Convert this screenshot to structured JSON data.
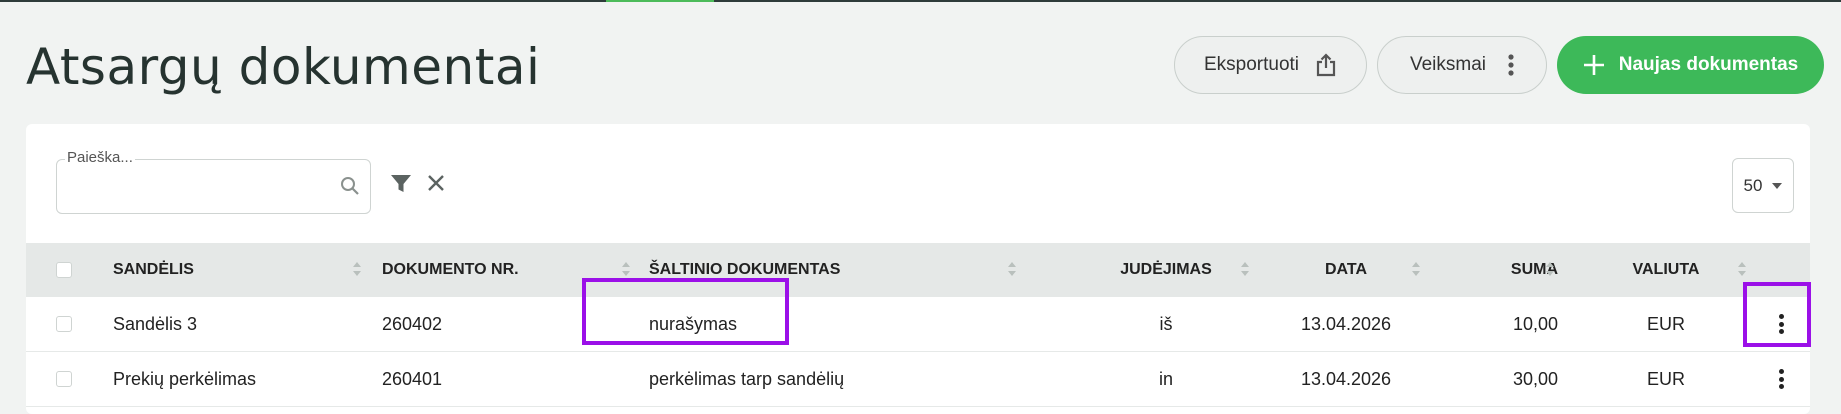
{
  "header": {
    "title": "Atsargų dokumentai",
    "export_label": "Eksportuoti",
    "actions_label": "Veiksmai",
    "new_label": "Naujas dokumentas"
  },
  "toolbar": {
    "search_label": "Paieška...",
    "search_value": "",
    "page_size": "50"
  },
  "table": {
    "columns": [
      "SANDĖLIS",
      "DOKUMENTO NR.",
      "ŠALTINIO DOKUMENTAS",
      "JUDĖJIMAS",
      "DATA",
      "SUMA",
      "VALIUTA"
    ],
    "rows": [
      [
        "Sandėlis 3",
        "260402",
        "nurašymas",
        "iš",
        "13.04.2026",
        "10,00",
        "EUR"
      ],
      [
        "Prekių perkėlimas",
        "260401",
        "perkėlimas tarp sandėlių",
        "in",
        "13.04.2026",
        "30,00",
        "EUR"
      ]
    ]
  },
  "colors": {
    "accent": "#3db959",
    "highlight": "#9b10e8",
    "background": "#f1f3f2"
  },
  "icons": [
    "share-icon",
    "kebab-icon",
    "plus-icon",
    "search-icon",
    "filter-icon",
    "close-icon",
    "chevron-down-icon",
    "sort-icon"
  ]
}
